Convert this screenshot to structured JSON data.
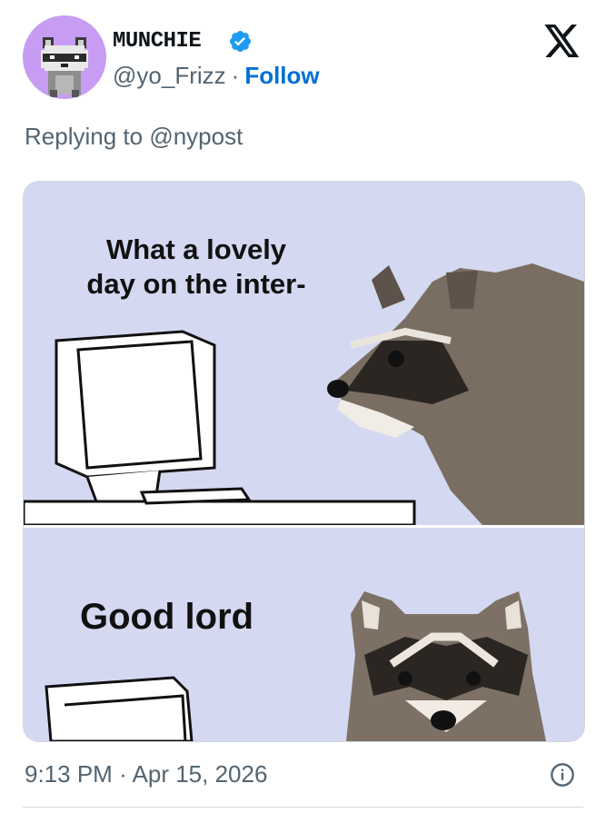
{
  "author": {
    "display_name": "MUNCHIE",
    "handle": "@yo_Frizz",
    "separator": "·",
    "follow_label": "Follow",
    "avatar_icon": "pixel-raccoon-avatar",
    "verified_icon": "verified-badge-icon"
  },
  "platform_icon": "x-logo-icon",
  "reply": {
    "prefix": "Replying to",
    "mention": "@nypost"
  },
  "media": {
    "top_caption": "What a lovely day on the inter-",
    "bottom_caption": "Good lord"
  },
  "meta": {
    "time": "9:13 PM",
    "separator": "·",
    "date": "Apr 15, 2026",
    "info_icon": "info-icon"
  },
  "colors": {
    "link": "#006fd6",
    "secondary_text": "#536471",
    "verified": "#1d9bf0",
    "avatar_bg": "#c79cf3",
    "meme_bg": "#d4d8f1"
  }
}
